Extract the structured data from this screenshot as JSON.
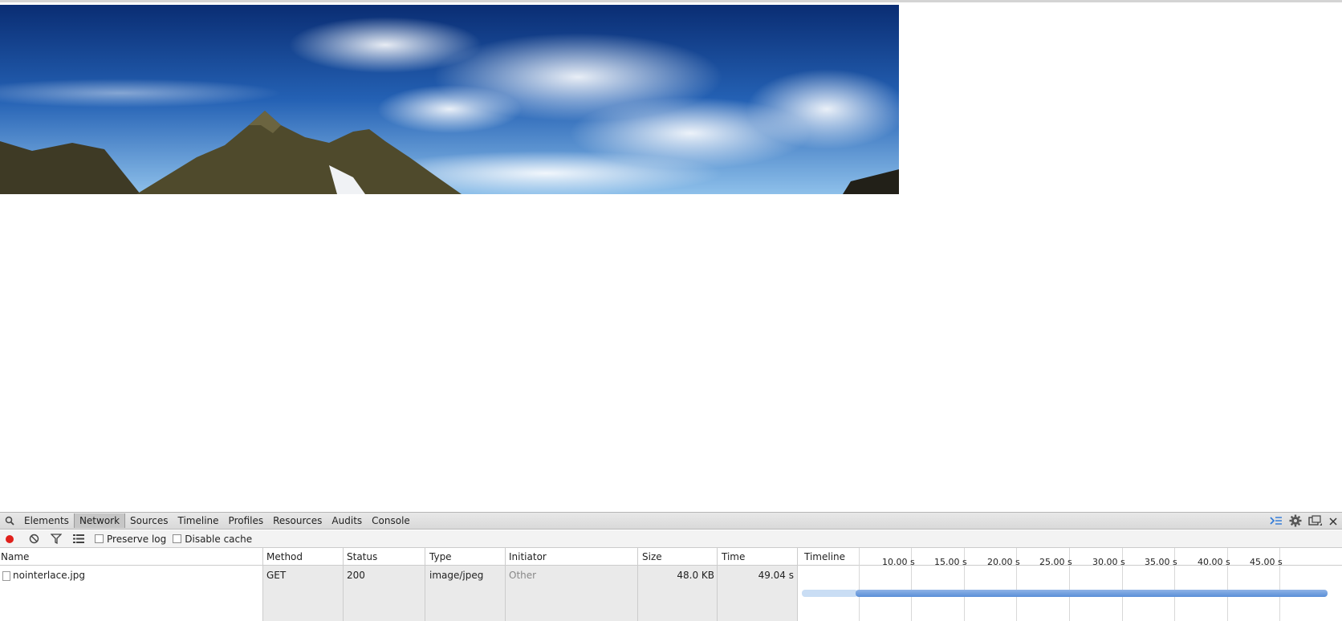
{
  "devtools": {
    "tabs": [
      "Elements",
      "Network",
      "Sources",
      "Timeline",
      "Profiles",
      "Resources",
      "Audits",
      "Console"
    ],
    "active_tab": "Network",
    "toolbar": {
      "preserve_log_label": "Preserve log",
      "disable_cache_label": "Disable cache"
    },
    "columns": {
      "name": "Name",
      "method": "Method",
      "status": "Status",
      "type": "Type",
      "initiator": "Initiator",
      "size": "Size",
      "time": "Time",
      "timeline": "Timeline"
    },
    "timeline_ticks": [
      "10.00 s",
      "15.00 s",
      "20.00 s",
      "25.00 s",
      "30.00 s",
      "35.00 s",
      "40.00 s",
      "45.00 s"
    ],
    "requests": [
      {
        "name": "nointerlace.jpg",
        "method": "GET",
        "status": "200",
        "type": "image/jpeg",
        "initiator": "Other",
        "size": "48.0 KB",
        "time": "49.04 s"
      }
    ],
    "icons": {
      "search": "search-icon",
      "record": "record-icon",
      "clear": "clear-icon",
      "filter": "filter-icon",
      "view": "list-view-icon",
      "drawer": "console-drawer-icon",
      "settings": "gear-icon",
      "dock": "dock-icon",
      "close": "close-icon"
    },
    "colors": {
      "record": "#e0201b",
      "bar_receive": "#5a8fd8",
      "bar_wait": "#c9ddf4"
    }
  }
}
